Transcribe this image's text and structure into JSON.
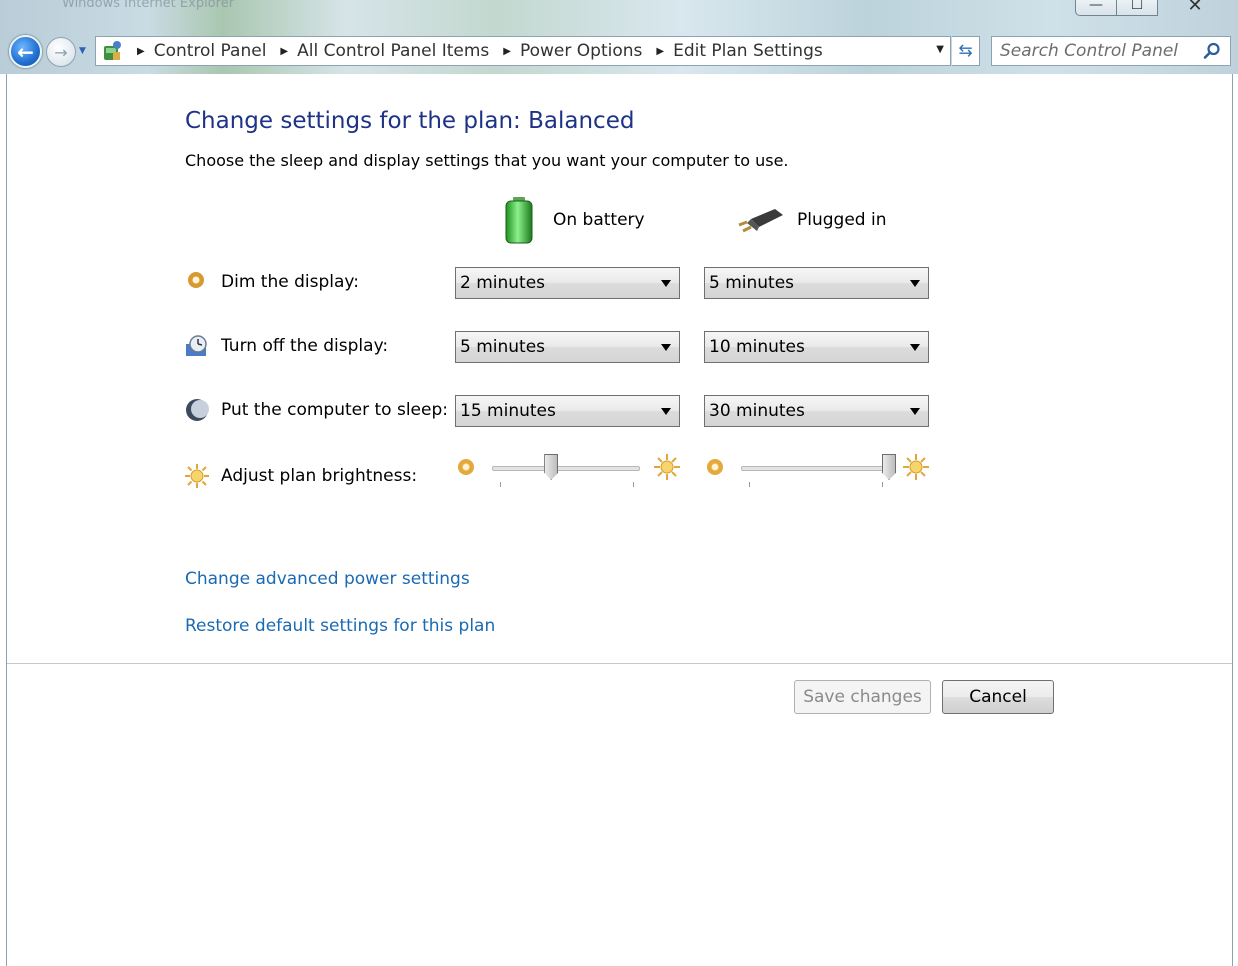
{
  "window": {
    "title": "Windows Internet Explorer",
    "min_glyph": "—",
    "max_glyph": "☐",
    "close_glyph": "✕"
  },
  "nav": {
    "back_glyph": "←",
    "forward_glyph": "→",
    "dropdown_glyph": "▼"
  },
  "address": {
    "crumbs": [
      "Control Panel",
      "All Control Panel Items",
      "Power Options",
      "Edit Plan Settings"
    ],
    "separator": "▶",
    "dropdown_glyph": "▼",
    "refresh_glyph": "⇆"
  },
  "search": {
    "placeholder": "Search Control Panel"
  },
  "page": {
    "title": "Change settings for the plan: Balanced",
    "subtitle": "Choose the sleep and display settings that you want your computer to use."
  },
  "columns": {
    "battery": "On battery",
    "plugged": "Plugged in"
  },
  "settings": [
    {
      "label": "Dim the display:",
      "battery": "2 minutes",
      "plugged": "5 minutes",
      "icon": "dim-display-icon"
    },
    {
      "label": "Turn off the display:",
      "battery": "5 minutes",
      "plugged": "10 minutes",
      "icon": "monitor-clock-icon"
    },
    {
      "label": "Put the computer to sleep:",
      "battery": "15 minutes",
      "plugged": "30 minutes",
      "icon": "moon-sleep-icon"
    }
  ],
  "brightness": {
    "label": "Adjust plan brightness:",
    "battery_level": 0.4,
    "plugged_level": 1.0
  },
  "links": {
    "advanced": "Change advanced power settings",
    "restore": "Restore default settings for this plan"
  },
  "buttons": {
    "save": "Save changes",
    "cancel": "Cancel"
  },
  "colors": {
    "title": "#1e3287",
    "link": "#1a6ab3",
    "battery_green": "#2fb52f"
  }
}
